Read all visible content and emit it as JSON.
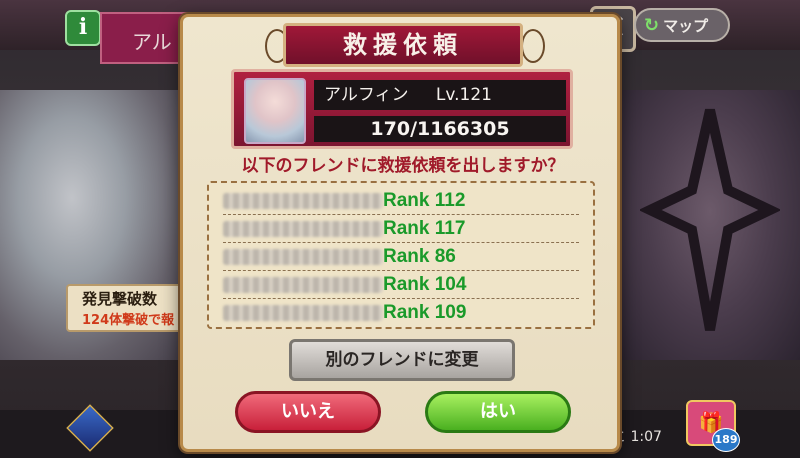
{
  "header": {
    "info_glyph": "i",
    "name_tab_text": "アル",
    "close_glyph": "✕",
    "map_label": "マップ"
  },
  "side_panel": {
    "title": "発見撃破数",
    "subtitle": "124体撃破で報"
  },
  "footer": {
    "timer": "と 1:07",
    "gift_badge": "189"
  },
  "dialog": {
    "title": "救援依頼",
    "character_name": "アルフィン",
    "level": "Lv.121",
    "hp": "170/1166305",
    "question": "以下のフレンドに救援依頼を出しますか？",
    "friends": [
      {
        "rank": "Rank 112"
      },
      {
        "rank": "Rank 117"
      },
      {
        "rank": "Rank 86"
      },
      {
        "rank": "Rank 104"
      },
      {
        "rank": "Rank 109"
      }
    ],
    "change_friend_label": "別のフレンドに変更",
    "no_label": "いいえ",
    "yes_label": "はい"
  },
  "icons": [
    "info-icon",
    "close-icon",
    "map-refresh-icon",
    "gem-icon",
    "gift-icon"
  ],
  "colors": {
    "title_plate": "#a01838",
    "rank_text": "#1a9a2a",
    "question_text": "#a01a2a",
    "yes_button": "#4ab020",
    "no_button": "#c8203a"
  }
}
